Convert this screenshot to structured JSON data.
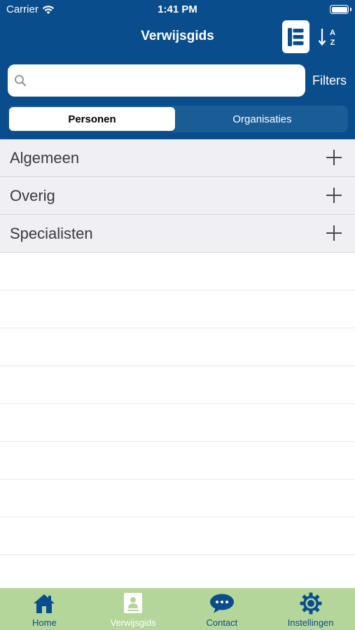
{
  "status_bar": {
    "carrier": "Carrier",
    "time": "1:41 PM"
  },
  "nav": {
    "title": "Verwijsgids",
    "list_mode_icon": "list-view-icon",
    "sort_icon": "sort-az-icon"
  },
  "search": {
    "value": "",
    "placeholder": "",
    "filters_label": "Filters"
  },
  "segments": [
    {
      "label": "Personen",
      "selected": true
    },
    {
      "label": "Organisaties",
      "selected": false
    }
  ],
  "sections": [
    {
      "label": "Algemeen"
    },
    {
      "label": "Overig"
    },
    {
      "label": "Specialisten"
    }
  ],
  "tabbar": {
    "tabs": [
      {
        "label": "Home",
        "icon": "home-icon",
        "active": false
      },
      {
        "label": "Verwijsgids",
        "icon": "contact-card-icon",
        "active": true
      },
      {
        "label": "Contact",
        "icon": "chat-bubble-icon",
        "active": false
      },
      {
        "label": "Instellingen",
        "icon": "gear-icon",
        "active": false
      }
    ]
  },
  "colors": {
    "header": "#0a4d8c",
    "tabbar": "#b5d69a",
    "section_bg": "#efeff4"
  }
}
